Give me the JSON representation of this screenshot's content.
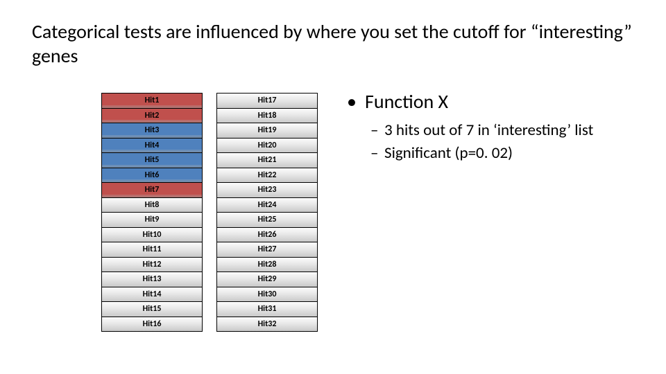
{
  "title": "Categorical tests are influenced by where you set the cutoff for “interesting” genes",
  "hits_col1": [
    {
      "label": "Hit1",
      "color": "red"
    },
    {
      "label": "Hit2",
      "color": "red"
    },
    {
      "label": "Hit3",
      "color": "blue"
    },
    {
      "label": "Hit4",
      "color": "blue"
    },
    {
      "label": "Hit5",
      "color": "blue"
    },
    {
      "label": "Hit6",
      "color": "blue"
    },
    {
      "label": "Hit7",
      "color": "red"
    },
    {
      "label": "Hit8",
      "color": "grey"
    },
    {
      "label": "Hit9",
      "color": "grey"
    },
    {
      "label": "Hit10",
      "color": "grey"
    },
    {
      "label": "Hit11",
      "color": "grey"
    },
    {
      "label": "Hit12",
      "color": "grey"
    },
    {
      "label": "Hit13",
      "color": "grey"
    },
    {
      "label": "Hit14",
      "color": "grey"
    },
    {
      "label": "Hit15",
      "color": "grey"
    },
    {
      "label": "Hit16",
      "color": "grey"
    }
  ],
  "hits_col2": [
    {
      "label": "Hit17"
    },
    {
      "label": "Hit18"
    },
    {
      "label": "Hit19"
    },
    {
      "label": "Hit20"
    },
    {
      "label": "Hit21"
    },
    {
      "label": "Hit22"
    },
    {
      "label": "Hit23"
    },
    {
      "label": "Hit24"
    },
    {
      "label": "Hit25"
    },
    {
      "label": "Hit26"
    },
    {
      "label": "Hit27"
    },
    {
      "label": "Hit28"
    },
    {
      "label": "Hit29"
    },
    {
      "label": "Hit30"
    },
    {
      "label": "Hit31"
    },
    {
      "label": "Hit32"
    }
  ],
  "bullets": {
    "l1": "Function X",
    "l2a": "3 hits out of 7 in ‘interesting’ list",
    "l2b": "Significant (p=0. 02)"
  },
  "cutoff_count": 7
}
